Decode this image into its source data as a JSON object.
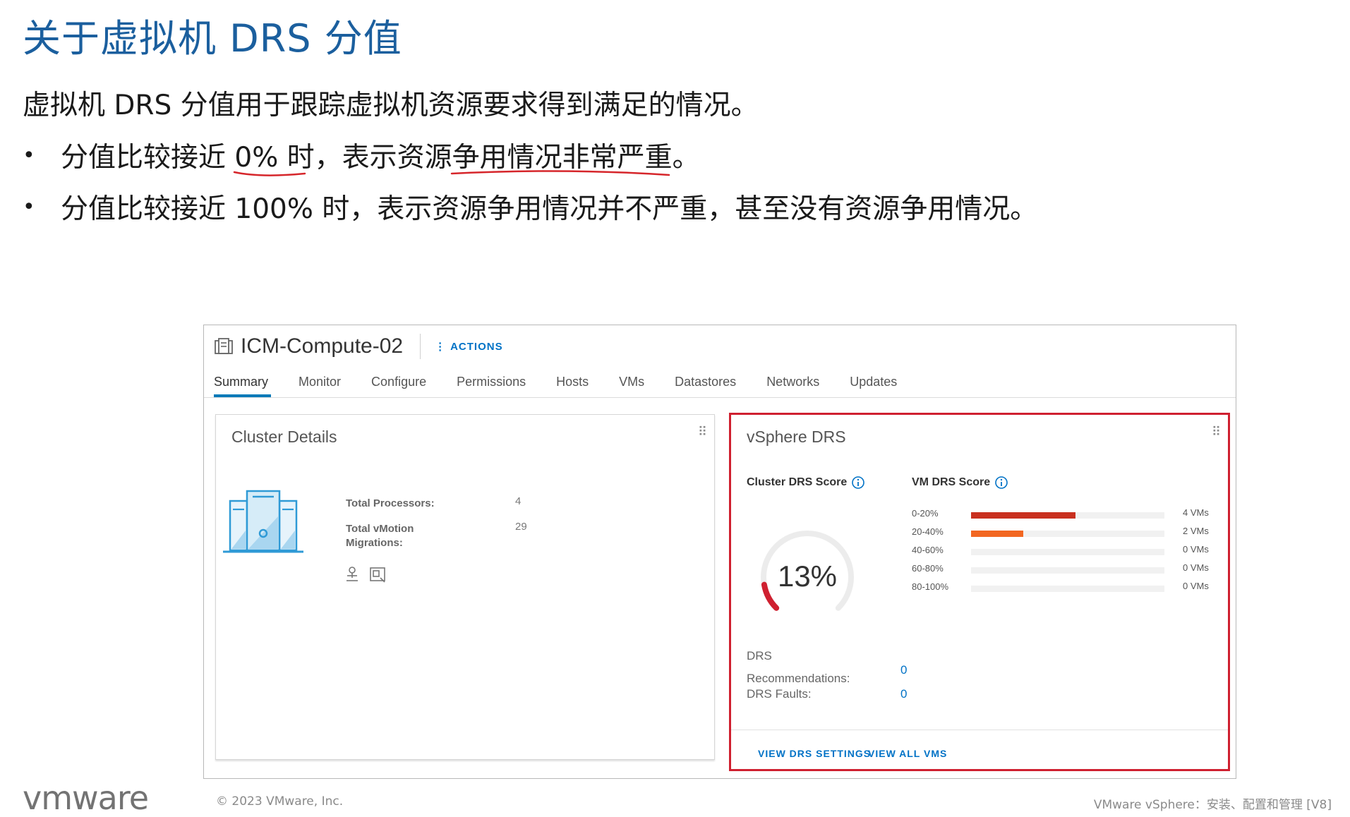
{
  "slide": {
    "title": "关于虚拟机 DRS 分值",
    "intro": "虚拟机 DRS 分值用于跟踪虚拟机资源要求得到满足的情况。",
    "bullets": [
      "分值比较接近 0% 时，表示资源争用情况非常严重。",
      "分值比较接近 100% 时，表示资源争用情况并不严重，甚至没有资源争用情况。"
    ],
    "bullet_symbol": "•",
    "annotation_color": "#d6262b"
  },
  "screenshot": {
    "cluster_name": "ICM-Compute-02",
    "actions_label": "ACTIONS",
    "tabs": [
      {
        "label": "Summary",
        "active": true
      },
      {
        "label": "Monitor",
        "active": false
      },
      {
        "label": "Configure",
        "active": false
      },
      {
        "label": "Permissions",
        "active": false
      },
      {
        "label": "Hosts",
        "active": false
      },
      {
        "label": "VMs",
        "active": false
      },
      {
        "label": "Datastores",
        "active": false
      },
      {
        "label": "Networks",
        "active": false
      },
      {
        "label": "Updates",
        "active": false
      }
    ],
    "cluster_details": {
      "title": "Cluster Details",
      "total_processors_label": "Total Processors:",
      "total_processors_value": "4",
      "total_vmotion_label": "Total vMotion Migrations:",
      "total_vmotion_value": "29",
      "icons": [
        "host-action-icon",
        "vm-action-icon"
      ]
    },
    "vsphere_drs": {
      "title": "vSphere DRS",
      "highlight_color": "#cf2030",
      "cluster_score_label": "Cluster DRS Score",
      "cluster_score_value": "13%",
      "cluster_score_fraction": 0.13,
      "vm_score_label": "VM DRS Score",
      "histogram": [
        {
          "range": "0-20%",
          "count": "4 VMs",
          "fill": 0.54,
          "color": "#c9301f"
        },
        {
          "range": "20-40%",
          "count": "2 VMs",
          "fill": 0.27,
          "color": "#f26722"
        },
        {
          "range": "40-60%",
          "count": "0 VMs",
          "fill": 0,
          "color": "#f1f1f1"
        },
        {
          "range": "60-80%",
          "count": "0 VMs",
          "fill": 0,
          "color": "#f1f1f1"
        },
        {
          "range": "80-100%",
          "count": "0 VMs",
          "fill": 0,
          "color": "#f1f1f1"
        }
      ],
      "recommendations_label": "DRS Recommendations:",
      "recommendations_value": "0",
      "faults_label": "DRS Faults:",
      "faults_value": "0",
      "view_settings_label": "VIEW DRS SETTINGS",
      "view_vms_label": "VIEW ALL VMS"
    }
  },
  "footer": {
    "logo": "vmware",
    "copyright": "© 2023 VMware, Inc.",
    "course": "VMware vSphere：安装、配置和管理 [V8]"
  }
}
